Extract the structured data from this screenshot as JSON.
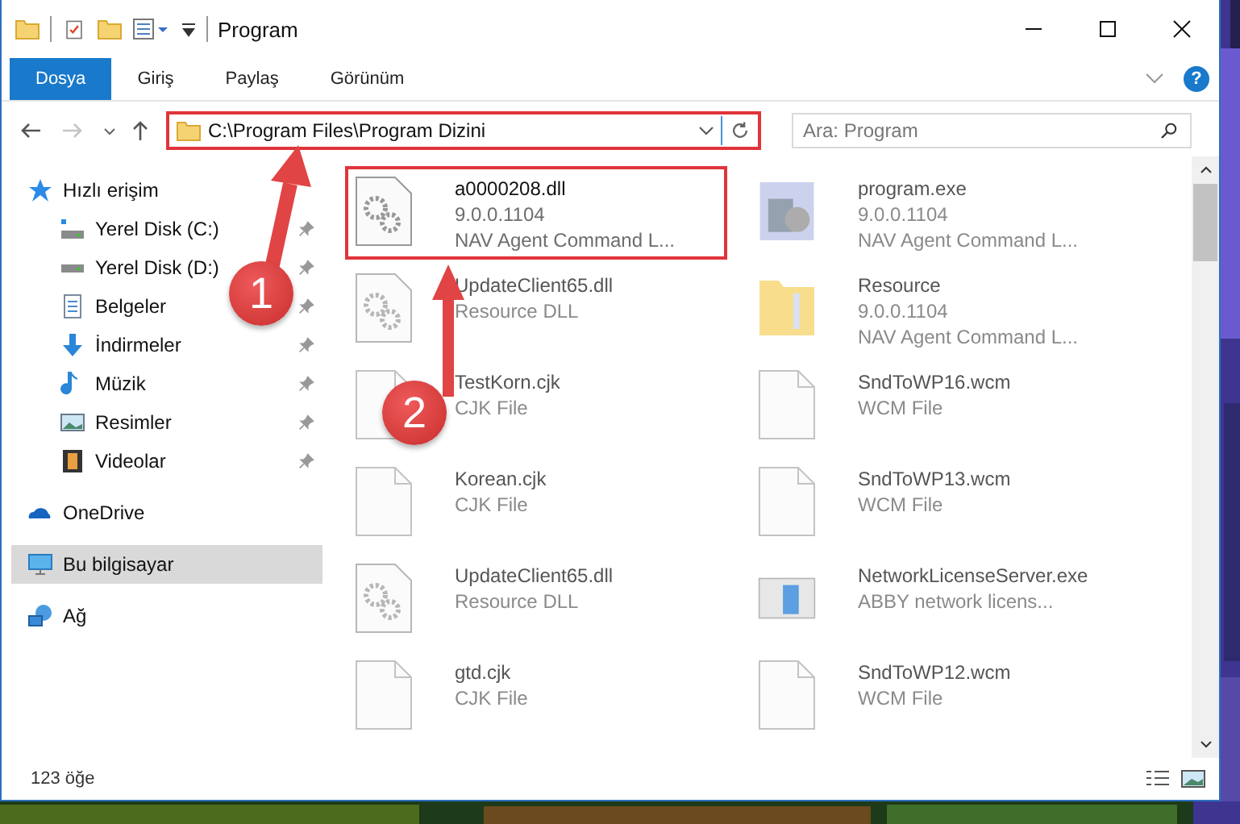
{
  "window": {
    "title": "Program"
  },
  "ribbon_tabs": [
    {
      "label": "Dosya",
      "selected": true
    },
    {
      "label": "Giriş",
      "selected": false
    },
    {
      "label": "Paylaş",
      "selected": false
    },
    {
      "label": "Görünüm",
      "selected": false
    }
  ],
  "help": {
    "label": "?"
  },
  "address_bar": {
    "value": "C:\\Program Files\\Program Dizini",
    "highlighted": true
  },
  "search": {
    "placeholder": "Ara: Program"
  },
  "sidebar": {
    "items": [
      {
        "label": "Hızlı erişim",
        "selected": false,
        "children": [
          {
            "label": "Yerel Disk (C:)",
            "pinned": true
          },
          {
            "label": "Yerel Disk (D:)",
            "pinned": true
          },
          {
            "label": "Belgeler",
            "pinned": true
          },
          {
            "label": "İndirmeler",
            "pinned": true
          },
          {
            "label": "Müzik",
            "pinned": true
          },
          {
            "label": "Resimler",
            "pinned": true
          },
          {
            "label": "Videolar",
            "pinned": true
          }
        ]
      },
      {
        "label": "OneDrive",
        "selected": false
      },
      {
        "label": "Bu bilgisayar",
        "selected": true
      },
      {
        "label": "Ağ",
        "selected": false
      }
    ]
  },
  "files": [
    {
      "kind": "dll",
      "name": "a0000208.dll",
      "details": [
        "9.0.0.1104",
        "NAV Agent Command L..."
      ],
      "highlighted": true,
      "blurred": false
    },
    {
      "kind": "exe",
      "name": "program.exe",
      "details": [
        "9.0.0.1104",
        "NAV Agent Command L..."
      ],
      "highlighted": false,
      "blurred": true
    },
    {
      "kind": "dll",
      "name": "UpdateClient65.dll",
      "details": [
        "Resource DLL"
      ],
      "highlighted": false,
      "blurred": true
    },
    {
      "kind": "folder",
      "name": "Resource",
      "details": [
        "9.0.0.1104",
        "NAV Agent Command L..."
      ],
      "highlighted": false,
      "blurred": true
    },
    {
      "kind": "file",
      "name": "TestKorn.cjk",
      "details": [
        "CJK File"
      ],
      "highlighted": false,
      "blurred": true
    },
    {
      "kind": "file",
      "name": "SndToWP16.wcm",
      "details": [
        "WCM File"
      ],
      "highlighted": false,
      "blurred": true
    },
    {
      "kind": "file",
      "name": "Korean.cjk",
      "details": [
        "CJK File"
      ],
      "highlighted": false,
      "blurred": true
    },
    {
      "kind": "file",
      "name": "SndToWP13.wcm",
      "details": [
        "WCM File"
      ],
      "highlighted": false,
      "blurred": true
    },
    {
      "kind": "dll",
      "name": "UpdateClient65.dll",
      "details": [
        "Resource DLL"
      ],
      "highlighted": false,
      "blurred": true
    },
    {
      "kind": "server",
      "name": "NetworkLicenseServer.exe",
      "details": [
        "ABBY network licens..."
      ],
      "highlighted": false,
      "blurred": true
    },
    {
      "kind": "file",
      "name": "gtd.cjk",
      "details": [
        "CJK File"
      ],
      "highlighted": false,
      "blurred": true
    },
    {
      "kind": "file",
      "name": "SndToWP12.wcm",
      "details": [
        "WCM File"
      ],
      "highlighted": false,
      "blurred": true
    }
  ],
  "status_bar": {
    "count": "123 öğe"
  },
  "callouts": [
    {
      "number": "1"
    },
    {
      "number": "2"
    }
  ]
}
